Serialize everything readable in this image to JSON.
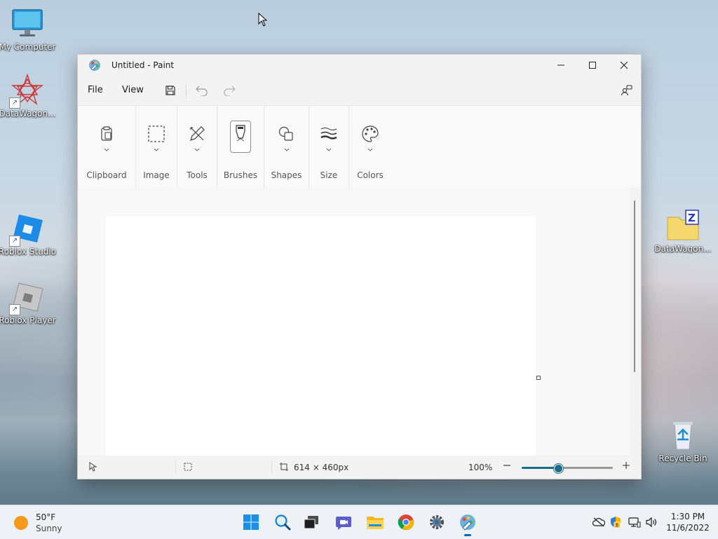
{
  "desktop": {
    "icons": [
      {
        "label": "My Computer"
      },
      {
        "label": "DataWagon..."
      },
      {
        "label": "Roblox Studio"
      },
      {
        "label": "Roblox Player"
      },
      {
        "label": "DataWagon..."
      },
      {
        "label": "Recycle Bin"
      }
    ]
  },
  "window": {
    "title": "Untitled - Paint",
    "app_icon": "paint-palette-icon",
    "controls": [
      "minimize",
      "maximize",
      "close"
    ]
  },
  "menubar": {
    "items": [
      {
        "label": "File"
      },
      {
        "label": "View"
      }
    ],
    "actions": [
      "save-icon",
      "undo-icon",
      "redo-icon",
      "share-icon"
    ]
  },
  "ribbon": {
    "groups": [
      {
        "label": "Clipboard",
        "icon": "clipboard-icon"
      },
      {
        "label": "Image",
        "icon": "selection-icon"
      },
      {
        "label": "Tools",
        "icon": "pencil-icon"
      },
      {
        "label": "Brushes",
        "icon": "brush-icon",
        "active": true
      },
      {
        "label": "Shapes",
        "icon": "shapes-icon"
      },
      {
        "label": "Size",
        "icon": "stroke-size-icon"
      },
      {
        "label": "Colors",
        "icon": "palette-icon"
      }
    ]
  },
  "statusbar": {
    "canvas_size": "614 × 460px",
    "zoom": "100%",
    "zoom_level": 0.4
  },
  "taskbar": {
    "weather": {
      "temp": "50°F",
      "condition": "Sunny"
    },
    "apps": [
      "start-icon",
      "search-icon",
      "task-view-icon",
      "chat-icon",
      "file-explorer-icon",
      "chrome-icon",
      "settings-icon",
      "paint-icon"
    ],
    "clock": {
      "time": "1:30 PM",
      "date": "11/6/2022"
    }
  },
  "colors": {
    "accent": "#0067c0",
    "zoom_accent": "#1d6a8a",
    "sun": "#f39a1d"
  }
}
